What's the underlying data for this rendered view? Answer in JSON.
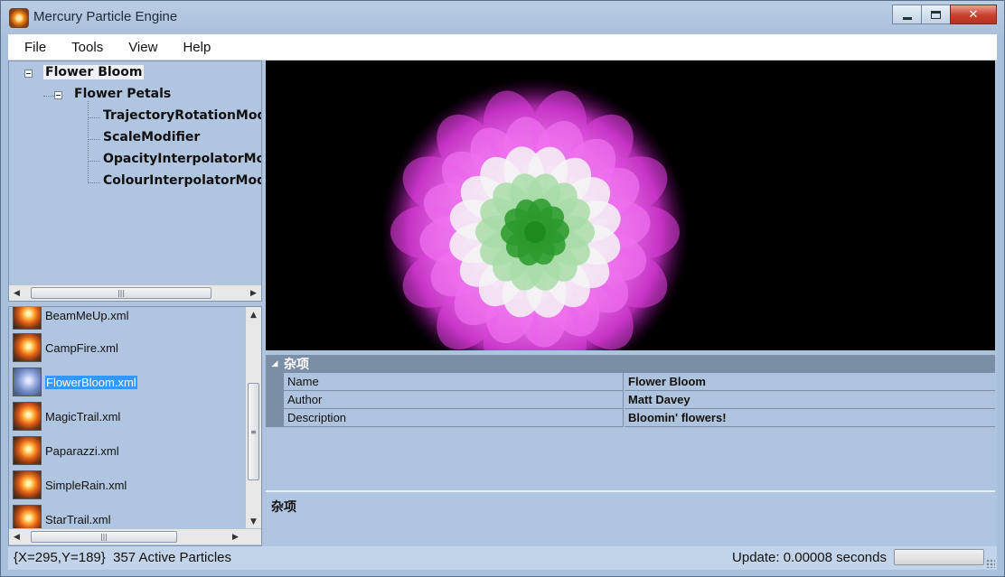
{
  "window": {
    "title": "Mercury Particle Engine"
  },
  "menu": [
    "File",
    "Tools",
    "View",
    "Help"
  ],
  "tree": {
    "root": "Flower Bloom",
    "emitter": "Flower Petals",
    "modifiers": [
      "TrajectoryRotationMod",
      "ScaleModifier",
      "OpacityInterpolatorMoc",
      "ColourInterpolatorModi"
    ]
  },
  "files": [
    {
      "name": "BeamMeUp.xml",
      "selected": false
    },
    {
      "name": "CampFire.xml",
      "selected": false
    },
    {
      "name": "FlowerBloom.xml",
      "selected": true
    },
    {
      "name": "MagicTrail.xml",
      "selected": false
    },
    {
      "name": "Paparazzi.xml",
      "selected": false
    },
    {
      "name": "SimpleRain.xml",
      "selected": false
    },
    {
      "name": "StarTrail.xml",
      "selected": false
    }
  ],
  "properties": {
    "category": "杂项",
    "rows": [
      {
        "name": "Name",
        "value": "Flower Bloom"
      },
      {
        "name": "Author",
        "value": "Matt Davey"
      },
      {
        "name": "Description",
        "value": "Bloomin' flowers!"
      }
    ]
  },
  "description_panel": {
    "title": "杂项"
  },
  "status": {
    "coords": "{X=295,Y=189}",
    "particles": "357 Active Particles",
    "update": "Update: 0.00008 seconds"
  },
  "colors": {
    "panel_bg": "#b0c6e0",
    "selection": "#3399ff",
    "petal_magenta": "#e040e0",
    "petal_white": "#f4f4f4",
    "petal_green": "#2a9a2a"
  },
  "icons": {
    "app": "particle-engine-icon",
    "file": "particle-effect-icon",
    "tree_expander": "minus-box-icon"
  }
}
